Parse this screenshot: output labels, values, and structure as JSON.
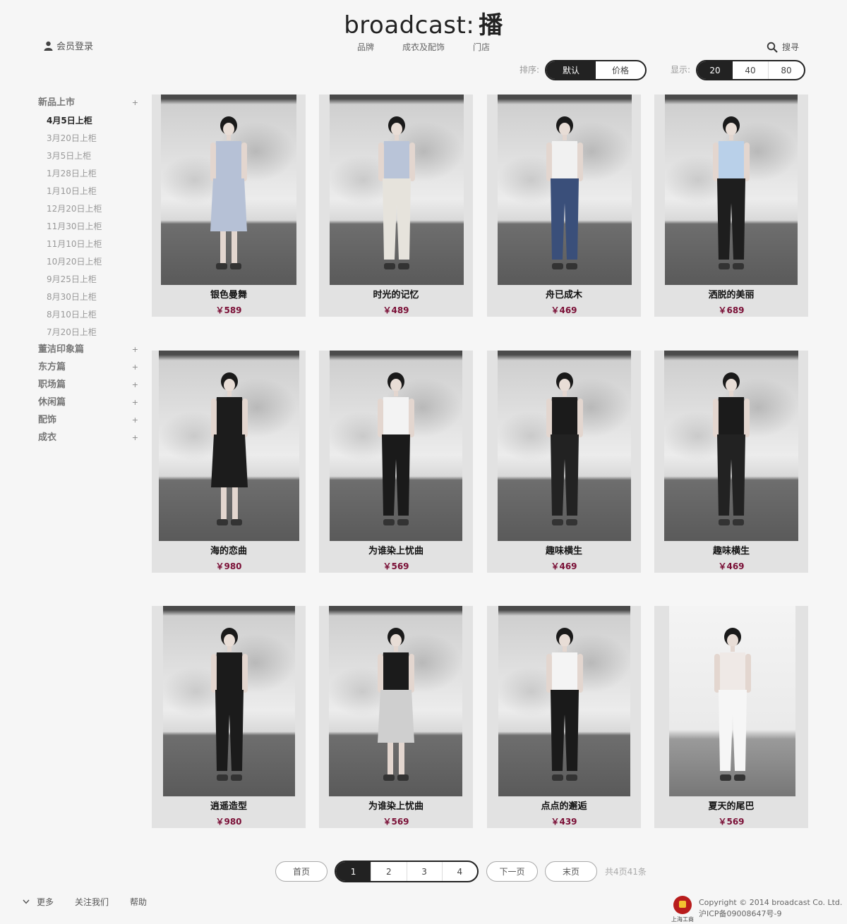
{
  "header": {
    "logo_en": "broadcast:",
    "logo_cn": "播",
    "member_login": "会员登录",
    "search": "搜寻",
    "nav": [
      "品牌",
      "成衣及配饰",
      "门店"
    ]
  },
  "controls": {
    "sort_label": "排序:",
    "sort_options": [
      "默认",
      "价格"
    ],
    "sort_selected": "默认",
    "display_label": "显示:",
    "display_options": [
      "20",
      "40",
      "80"
    ],
    "display_selected": "20"
  },
  "sidebar": {
    "new_arrivals": {
      "label": "新品上市",
      "expand": "+"
    },
    "sub_items": [
      "4月5日上柜",
      "3月20日上柜",
      "3月5日上柜",
      "1月28日上柜",
      "1月10日上柜",
      "12月20日上柜",
      "11月30日上柜",
      "11月10日上柜",
      "10月20日上柜",
      "9月25日上柜",
      "8月30日上柜",
      "8月10日上柜",
      "7月20日上柜"
    ],
    "active_sub": "4月5日上柜",
    "categories": [
      {
        "label": "董洁印象篇",
        "expand": "+"
      },
      {
        "label": "东方篇",
        "expand": "+"
      },
      {
        "label": "职场篇",
        "expand": "+"
      },
      {
        "label": "休闲篇",
        "expand": "+"
      },
      {
        "label": "配饰",
        "expand": "+"
      },
      {
        "label": "成衣",
        "expand": "+"
      }
    ]
  },
  "products": [
    {
      "name": "银色曼舞",
      "price": "￥589"
    },
    {
      "name": "时光的记忆",
      "price": "￥489"
    },
    {
      "name": "舟已成木",
      "price": "￥469"
    },
    {
      "name": "洒脱的美丽",
      "price": "￥689"
    },
    {
      "name": "海的恋曲",
      "price": "￥980"
    },
    {
      "name": "为谁染上忧曲",
      "price": "￥569"
    },
    {
      "name": "趣味横生",
      "price": "￥469"
    },
    {
      "name": "趣味横生",
      "price": "￥469"
    },
    {
      "name": "逍遥造型",
      "price": "￥980"
    },
    {
      "name": "为谁染上忧曲",
      "price": "￥569"
    },
    {
      "name": "点点的邂逅",
      "price": "￥439"
    },
    {
      "name": "夏天的尾巴",
      "price": "￥569"
    }
  ],
  "pagination": {
    "first": "首页",
    "pages": [
      "1",
      "2",
      "3",
      "4"
    ],
    "current": "1",
    "next": "下一页",
    "last": "末页",
    "info": "共4页41条"
  },
  "footer": {
    "more": "更多",
    "follow": "关注我们",
    "help": "帮助",
    "badge_text": "上海工商",
    "copyright": "Copyright © 2014 broadcast Co. Ltd.",
    "icp": "沪ICP备09008647号-9"
  }
}
